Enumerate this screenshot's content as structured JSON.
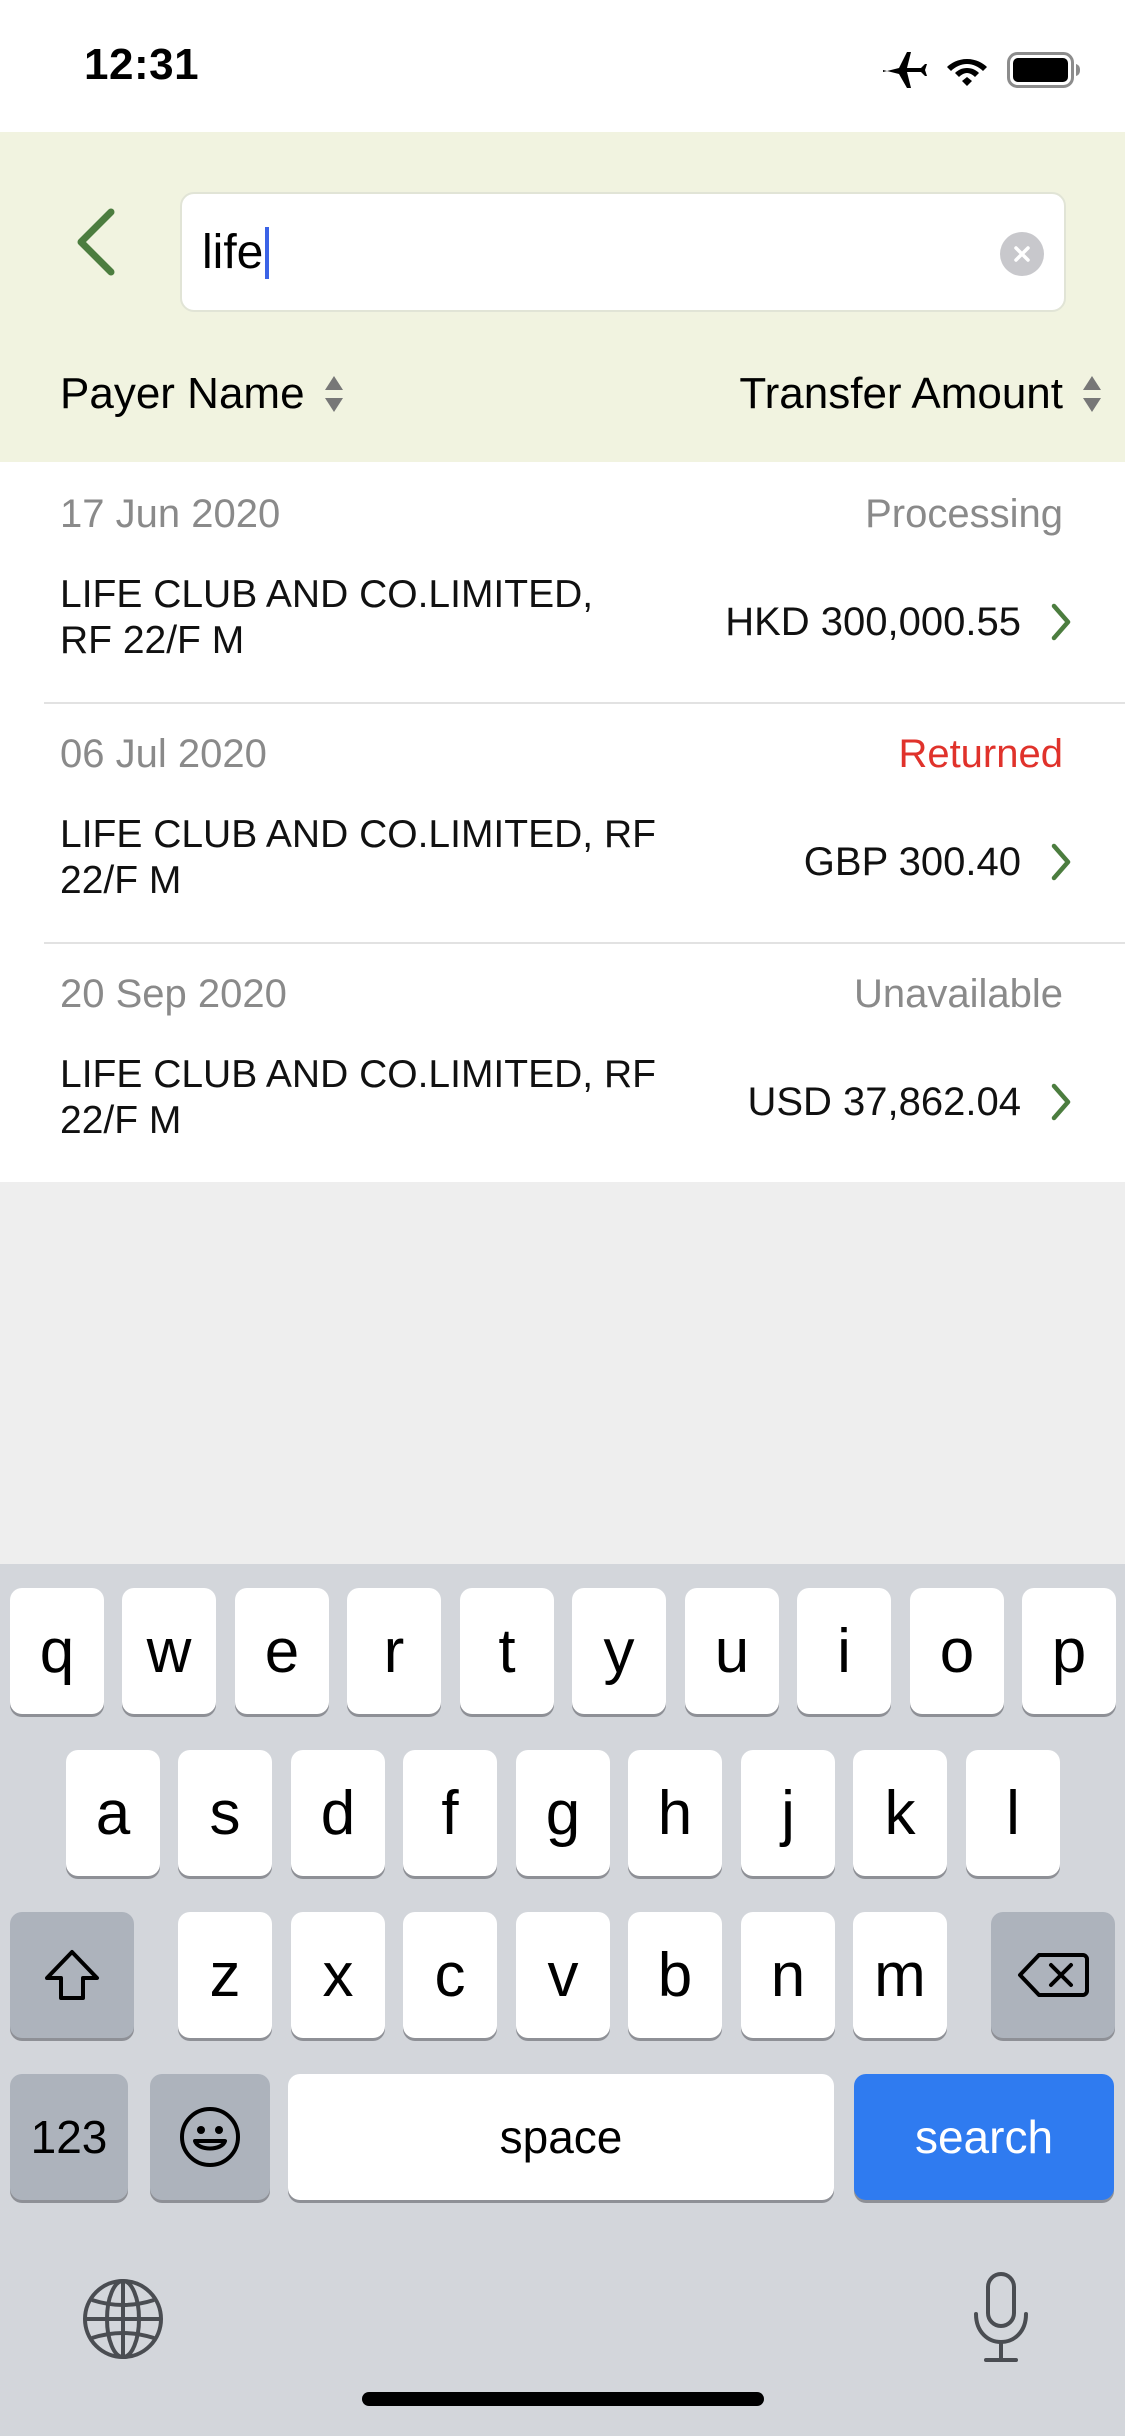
{
  "status_bar": {
    "time": "12:31"
  },
  "search": {
    "value": "life"
  },
  "sort": {
    "payer_label": "Payer Name",
    "amount_label": "Transfer Amount"
  },
  "transactions": [
    {
      "date": "17 Jun 2020",
      "status": "Processing",
      "payer_line1": "LIFE CLUB AND CO.LIMITED,",
      "payer_line2": "RF 22/F M",
      "amount": "HKD 300,000.55"
    },
    {
      "date": "06 Jul 2020",
      "status": "Returned",
      "payer_line1": "LIFE CLUB AND CO.LIMITED, RF",
      "payer_line2": "22/F M",
      "amount": "GBP 300.40"
    },
    {
      "date": "20 Sep 2020",
      "status": "Unavailable",
      "payer_line1": "LIFE CLUB AND CO.LIMITED, RF",
      "payer_line2": "22/F M",
      "amount": "USD 37,862.04"
    }
  ],
  "colors": {
    "accent": "#4c7d3f",
    "header_bg": "#f1f3e0",
    "returned": "#e0322b",
    "search_key": "#2f7bf0"
  },
  "keyboard": {
    "row1": [
      "q",
      "w",
      "e",
      "r",
      "t",
      "y",
      "u",
      "i",
      "o",
      "p"
    ],
    "row2": [
      "a",
      "s",
      "d",
      "f",
      "g",
      "h",
      "j",
      "k",
      "l"
    ],
    "row3": [
      "z",
      "x",
      "c",
      "v",
      "b",
      "n",
      "m"
    ],
    "num_label": "123",
    "space_label": "space",
    "search_label": "search"
  }
}
